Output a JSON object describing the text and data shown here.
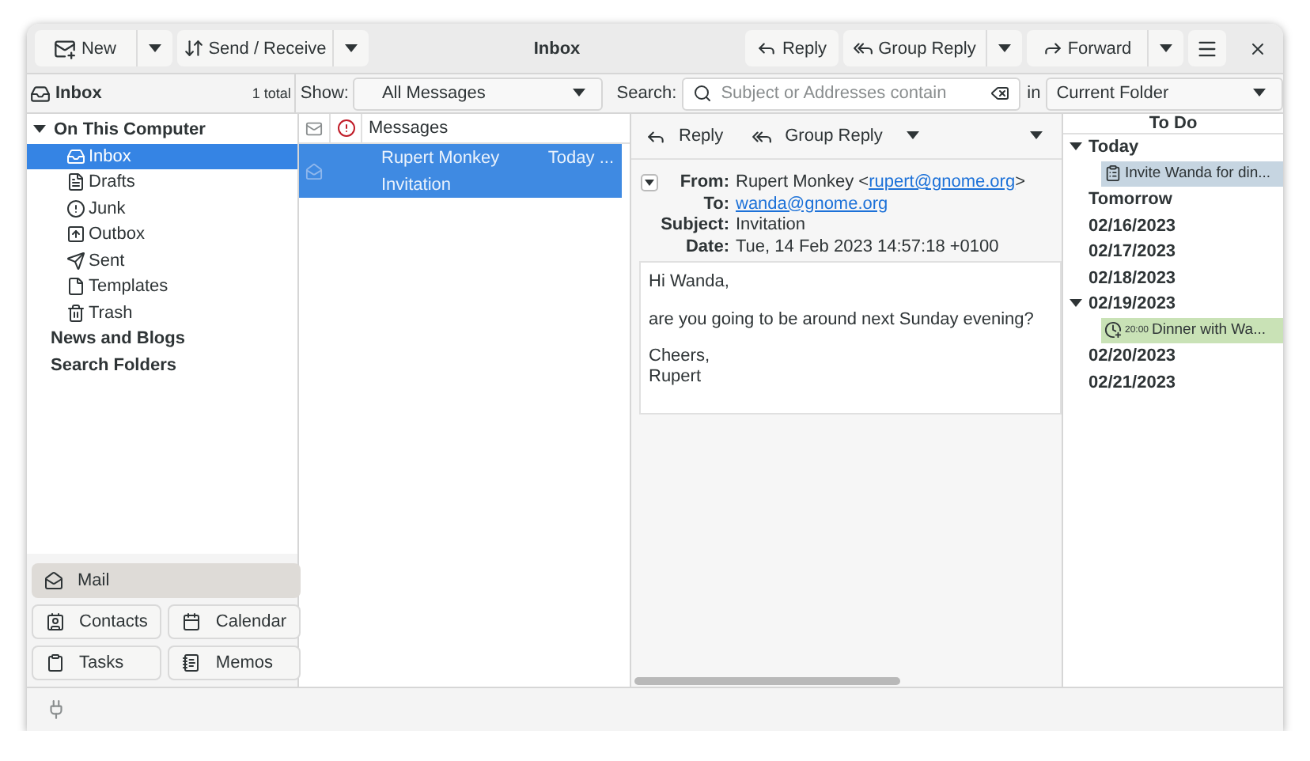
{
  "header": {
    "new_label": "New",
    "send_receive_label": "Send / Receive",
    "title": "Inbox",
    "reply": "Reply",
    "group_reply": "Group Reply",
    "forward": "Forward"
  },
  "folder_bar": {
    "name": "Inbox",
    "count": "1 total"
  },
  "filter": {
    "show_label": "Show:",
    "show_value": "All Messages",
    "search_label": "Search:",
    "search_placeholder": "Subject or Addresses contain",
    "in_label": "in",
    "scope": "Current Folder"
  },
  "folders": [
    {
      "label": "On This Computer",
      "expanded": true,
      "selected": false,
      "children": [
        {
          "label": "Inbox",
          "selected": true
        },
        {
          "label": "Drafts",
          "selected": false
        },
        {
          "label": "Junk",
          "selected": false
        },
        {
          "label": "Outbox",
          "selected": false
        },
        {
          "label": "Sent",
          "selected": false
        },
        {
          "label": "Templates",
          "selected": false
        },
        {
          "label": "Trash",
          "selected": false
        }
      ]
    },
    {
      "label": "News and Blogs",
      "selected": false
    },
    {
      "label": "Search Folders",
      "selected": false
    }
  ],
  "switcher": [
    {
      "label": "Mail",
      "selected": true
    },
    {
      "label": "Contacts",
      "selected": false
    },
    {
      "label": "Calendar",
      "selected": false
    },
    {
      "label": "Tasks",
      "selected": false
    },
    {
      "label": "Memos",
      "selected": false
    }
  ],
  "message_list": {
    "column": "Messages",
    "rows": [
      {
        "from": "Rupert Monkey",
        "date": "Today ...",
        "subject": "Invitation",
        "selected": true
      }
    ]
  },
  "preview": {
    "reply": "Reply",
    "group_reply": "Group Reply",
    "headers": [
      {
        "label": "From:",
        "parts": [
          {
            "kind": "text",
            "text": "Rupert Monkey <"
          },
          {
            "kind": "link",
            "text": "rupert@gnome.org"
          },
          {
            "kind": "text",
            "text": ">"
          }
        ]
      },
      {
        "label": "To:",
        "parts": [
          {
            "kind": "link",
            "text": "wanda@gnome.org"
          }
        ]
      },
      {
        "label": "Subject:",
        "parts": [
          {
            "kind": "text",
            "text": "Invitation"
          }
        ]
      },
      {
        "label": "Date:",
        "parts": [
          {
            "kind": "text",
            "text": "Tue, 14 Feb 2023 14:57:18 +0100"
          }
        ]
      }
    ],
    "body": [
      "Hi Wanda,",
      "are you going to be around next Sunday evening?",
      "Cheers,\nRupert"
    ]
  },
  "todo": {
    "title": "To Do",
    "groups": [
      {
        "label": "Today",
        "expanded": true,
        "children": [
          {
            "kind": "task",
            "text": "Invite Wanda for din...",
            "color": "#c6d5e1"
          }
        ]
      },
      {
        "label": "Tomorrow"
      },
      {
        "label": "02/16/2023"
      },
      {
        "label": "02/17/2023"
      },
      {
        "label": "02/18/2023"
      },
      {
        "label": "02/19/2023",
        "expanded": true,
        "children": [
          {
            "kind": "event",
            "time": "20:00",
            "text": "Dinner with Wa...",
            "color": "#c9e2b6"
          }
        ]
      },
      {
        "label": "02/20/2023"
      },
      {
        "label": "02/21/2023"
      }
    ]
  }
}
